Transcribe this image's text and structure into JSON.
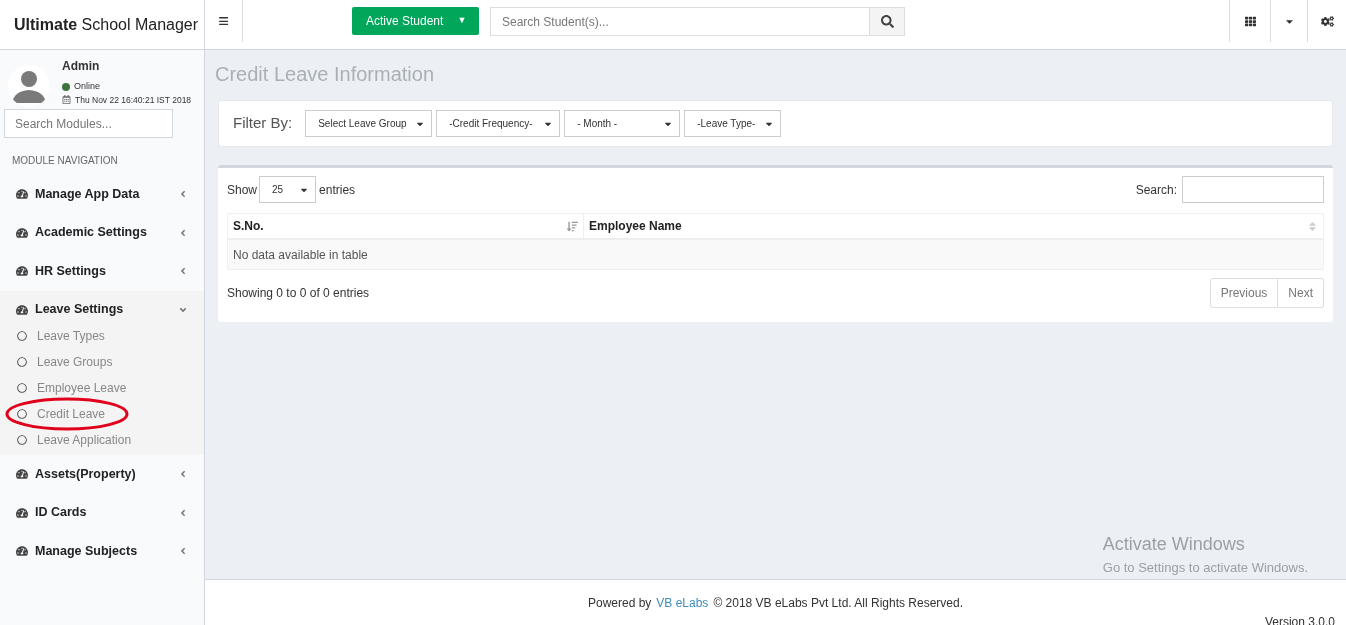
{
  "header": {
    "brand_bold": "Ultimate",
    "brand_rest": "School Manager",
    "menu_glyph": "≡",
    "student_button": "Active Student",
    "student_caret": "▼",
    "search": {
      "placeholder": "Search Student(s)..."
    }
  },
  "user": {
    "name": "Admin",
    "status": "Online",
    "online": true,
    "datetime": "Thu Nov 22 16:40:21 IST 2018"
  },
  "sidebar": {
    "search": {
      "placeholder": "Search Modules..."
    },
    "heading": "MODULE NAVIGATION",
    "items": [
      {
        "label": "Manage App Data",
        "expanded": false
      },
      {
        "label": "Academic Settings",
        "expanded": false
      },
      {
        "label": "HR Settings",
        "expanded": false
      },
      {
        "label": "Leave Settings",
        "expanded": true,
        "children": [
          {
            "label": "Leave Types",
            "circled": false
          },
          {
            "label": "Leave Groups",
            "circled": false
          },
          {
            "label": "Employee Leave",
            "circled": false
          },
          {
            "label": "Credit Leave",
            "circled": true
          },
          {
            "label": "Leave Application",
            "circled": false
          }
        ]
      },
      {
        "label": "Assets(Property)",
        "expanded": false
      },
      {
        "label": "ID Cards",
        "expanded": false
      },
      {
        "label": "Manage Subjects",
        "expanded": false
      }
    ]
  },
  "page_title": "Credit Leave Information",
  "filter": {
    "label": "Filter By:",
    "selects": [
      "Select Leave Group",
      "-Credit Frequency-",
      "- Month -",
      "-Leave Type-"
    ]
  },
  "table": {
    "show_label": "Show",
    "page_size": "25",
    "entries_label": "entries",
    "search_label": "Search:",
    "columns": [
      "S.No.",
      "Employee Name"
    ],
    "empty": "No data available in table",
    "info": "Showing 0 to 0 of 0 entries",
    "pagination": [
      {
        "label": "Previous",
        "disabled": true
      },
      {
        "label": "Next",
        "disabled": true
      }
    ]
  },
  "os_notice": {
    "title": "Activate Windows",
    "text": "Go to Settings to activate Windows."
  },
  "footer": {
    "prefix": "Powered by",
    "link": "VB eLabs",
    "rest": "© 2018 VB eLabs Pvt Ltd. All Rights Reserved.",
    "version": "Version 3.0.0"
  }
}
